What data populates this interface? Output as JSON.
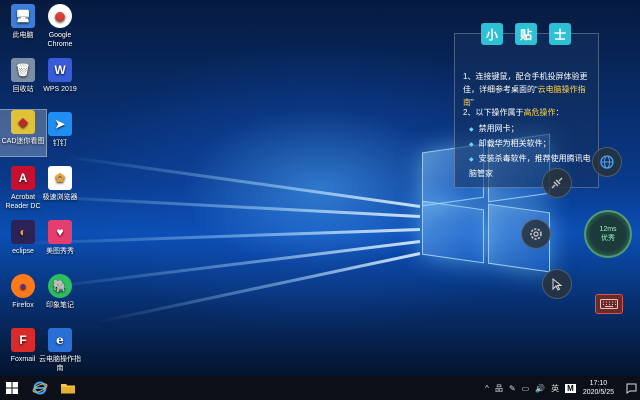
{
  "desktop_icons": [
    {
      "label": "此电脑",
      "glyph": "🖥",
      "bg": "#3b7dd8"
    },
    {
      "label": "Google Chrome",
      "glyph": "◉",
      "bg": "#ffffff"
    },
    {
      "label": "回收站",
      "glyph": "🗑",
      "bg": "#7a8ea6"
    },
    {
      "label": "WPS 2019",
      "glyph": "W",
      "bg": "#3a5bd9"
    },
    {
      "label": "CAD迷你看图",
      "glyph": "◆",
      "bg": "#e0c23a"
    },
    {
      "label": "钉钉",
      "glyph": "➤",
      "bg": "#1f8ef1"
    },
    {
      "label": "Acrobat Reader DC",
      "glyph": "A",
      "bg": "#c8102e"
    },
    {
      "label": "极速浏览器",
      "glyph": "✿",
      "bg": "#ffffff"
    },
    {
      "label": "eclipse",
      "glyph": "◐",
      "bg": "#2c2255"
    },
    {
      "label": "美图秀秀",
      "glyph": "♥",
      "bg": "#e63d6f"
    },
    {
      "label": "Firefox",
      "glyph": "●",
      "bg": "#ff7a1a"
    },
    {
      "label": "印象笔记",
      "glyph": "🐘",
      "bg": "#2dbe60"
    },
    {
      "label": "Foxmail",
      "glyph": "F",
      "bg": "#d92b2b"
    },
    {
      "label": "云电脑操作指南",
      "glyph": "e",
      "bg": "#2a6fd6"
    }
  ],
  "tips": {
    "title_chars": [
      "小",
      "贴",
      "士"
    ],
    "p1_a": "1、连接键鼠，配合手机投屏体验更佳，详细参考桌面的“",
    "p1_highlight": "云电脑操作指南",
    "p1_b": "”",
    "p2_a": "2、以下操作属于",
    "p2_highlight": "高危操作",
    "p2_b": "：",
    "items": [
      "禁用网卡；",
      "卸载华为相关软件；",
      "安装杀毒软件，推荐使用腾讯电脑管家"
    ]
  },
  "float_controls": {
    "latency_value": "12ms",
    "latency_status": "优秀"
  },
  "taskbar": {
    "tray_icons": [
      "^",
      "品",
      "✎",
      "▭",
      "🔊",
      "英",
      "M"
    ],
    "time": "17:10",
    "date": "2020/5/25"
  }
}
